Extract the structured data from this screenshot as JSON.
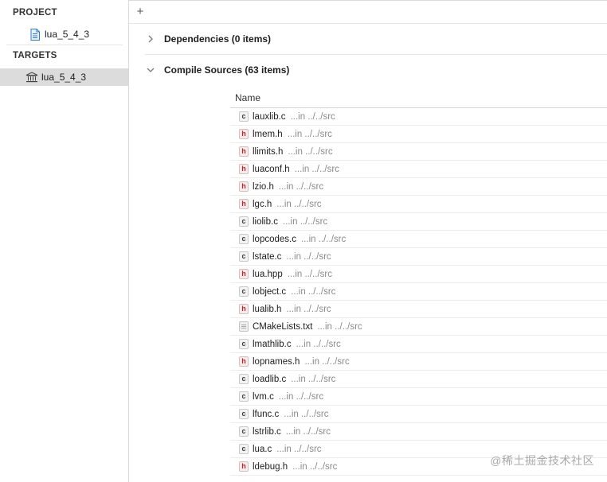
{
  "sidebar": {
    "project_heading": "PROJECT",
    "project_item": "lua_5_4_3",
    "targets_heading": "TARGETS",
    "target_item": "lua_5_4_3",
    "selection_color": "#dcdcdc"
  },
  "toolbar": {
    "add_label": "+"
  },
  "phases": {
    "dependencies": "Dependencies (0 items)",
    "compile_sources": "Compile Sources (63 items)"
  },
  "table": {
    "column_name": "Name",
    "rows": [
      {
        "icon": "c",
        "name": "lauxlib.c",
        "location": "...in ../../src"
      },
      {
        "icon": "h",
        "name": "lmem.h",
        "location": "...in ../../src"
      },
      {
        "icon": "h",
        "name": "llimits.h",
        "location": "...in ../../src"
      },
      {
        "icon": "h",
        "name": "luaconf.h",
        "location": "...in ../../src"
      },
      {
        "icon": "h",
        "name": "lzio.h",
        "location": "...in ../../src"
      },
      {
        "icon": "h",
        "name": "lgc.h",
        "location": "...in ../../src"
      },
      {
        "icon": "c",
        "name": "liolib.c",
        "location": "...in ../../src"
      },
      {
        "icon": "c",
        "name": "lopcodes.c",
        "location": "...in ../../src"
      },
      {
        "icon": "c",
        "name": "lstate.c",
        "location": "...in ../../src"
      },
      {
        "icon": "h",
        "name": "lua.hpp",
        "location": "...in ../../src"
      },
      {
        "icon": "c",
        "name": "lobject.c",
        "location": "...in ../../src"
      },
      {
        "icon": "h",
        "name": "lualib.h",
        "location": "...in ../../src"
      },
      {
        "icon": "doc",
        "name": "CMakeLists.txt",
        "location": "...in ../../src"
      },
      {
        "icon": "c",
        "name": "lmathlib.c",
        "location": "...in ../../src"
      },
      {
        "icon": "h",
        "name": "lopnames.h",
        "location": "...in ../../src"
      },
      {
        "icon": "c",
        "name": "loadlib.c",
        "location": "...in ../../src"
      },
      {
        "icon": "c",
        "name": "lvm.c",
        "location": "...in ../../src"
      },
      {
        "icon": "c",
        "name": "lfunc.c",
        "location": "...in ../../src"
      },
      {
        "icon": "c",
        "name": "lstrlib.c",
        "location": "...in ../../src"
      },
      {
        "icon": "c",
        "name": "lua.c",
        "location": "...in ../../src"
      },
      {
        "icon": "h",
        "name": "ldebug.h",
        "location": "...in ../../src"
      }
    ]
  },
  "watermark": "@稀土掘金技术社区"
}
